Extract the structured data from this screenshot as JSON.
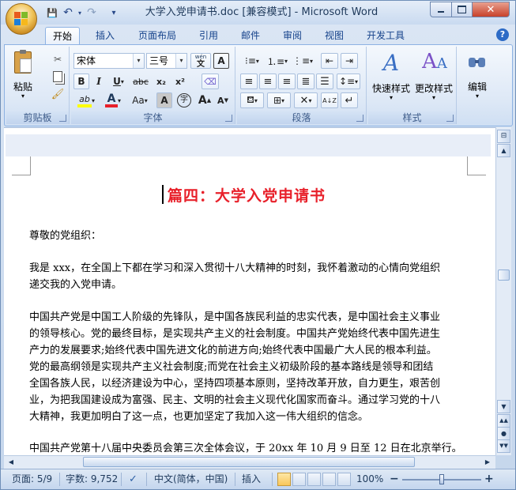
{
  "window": {
    "title": "大学入党申请书.doc [兼容模式] - Microsoft Word",
    "minimize_icon": "minimize-icon",
    "maximize_icon": "maximize-icon",
    "close_icon": "close-icon"
  },
  "quick_access": {
    "save": "💾",
    "undo": "↶",
    "redo": "↷",
    "customize": "▾"
  },
  "tabs": [
    {
      "label": "开始",
      "active": true
    },
    {
      "label": "插入"
    },
    {
      "label": "页面布局"
    },
    {
      "label": "引用"
    },
    {
      "label": "邮件"
    },
    {
      "label": "审阅"
    },
    {
      "label": "视图"
    },
    {
      "label": "开发工具"
    }
  ],
  "ribbon": {
    "clipboard": {
      "group_label": "剪贴板",
      "paste_label": "粘贴"
    },
    "font": {
      "group_label": "字体",
      "font_name": "宋体",
      "font_size": "三号",
      "bold": "B",
      "italic": "I",
      "underline": "U",
      "strikethrough": "abc",
      "subscript": "x₂",
      "superscript": "x²",
      "font_color_letter": "A",
      "change_case": "Aa",
      "char_shading": "A",
      "enclose": "字",
      "grow": "A",
      "shrink": "A",
      "highlight_letters": "ab",
      "phonetic": "wén",
      "phonetic_char": "文",
      "char_border": "A"
    },
    "paragraph": {
      "group_label": "段落",
      "sort": "A↓Z"
    },
    "styles": {
      "group_label": "样式",
      "quick_styles_label": "快速样式",
      "change_styles_label": "更改样式"
    },
    "editing": {
      "label": "编辑"
    }
  },
  "document": {
    "title": "篇四：大学入党申请书",
    "paragraphs": [
      [
        "尊敬的党组织："
      ],
      [
        "我是 xxx，在全国上下都在学习和深入贯彻十八大精神的时刻，我怀着激动的心情向党组织",
        "递交我的入党申请。"
      ],
      [
        "中国共产党是中国工人阶级的先锋队，是中国各族民利益的忠实代表，是中国社会主义事业",
        "的领导核心。党的最终目标，是实现共产主义的社会制度。中国共产党始终代表中国先进生",
        "产力的发展要求;始终代表中国先进文化的前进方向;始终代表中国最广大人民的根本利益。",
        "党的最高纲领是实现共产主义社会制度;而党在社会主义初级阶段的基本路线是领导和团结",
        "全国各族人民，以经济建设为中心，坚持四项基本原则，坚持改革开放，自力更生，艰苦创",
        "业，为把我国建设成为富强、民主、文明的社会主义现代化国家而奋斗。通过学习党的十八",
        "大精神，我更加明白了这一点，也更加坚定了我加入这一伟大组织的信念。"
      ],
      [
        "中国共产党第十八届中央委员会第三次全体会议，于 20xx 年 10 月 9 日至 12 日在北京举行。"
      ]
    ]
  },
  "status_bar": {
    "page": "页面: 5/9",
    "words": "字数: 9,752",
    "language": "中文(简体，中国)",
    "mode": "插入",
    "zoom": "100%",
    "zoom_minus": "−",
    "zoom_plus": "+",
    "zoom_level": 0.5
  },
  "colors": {
    "title_red": "#e8202a",
    "ribbon_blue": "#15428b",
    "font_color_bar": "#e8202a",
    "highlight_bar": "#ffff00"
  }
}
